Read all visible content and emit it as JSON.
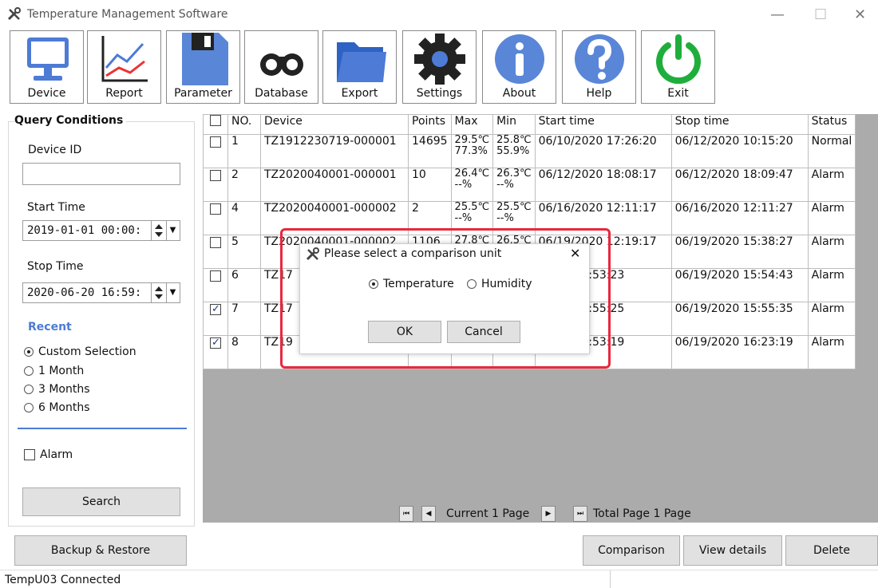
{
  "window": {
    "title": "Temperature Management Software",
    "minimize": "—",
    "maximize": "☐",
    "close": "✕"
  },
  "toolbar": [
    {
      "label": "Device",
      "icon": "monitor-icon"
    },
    {
      "label": "Report",
      "icon": "chart-icon"
    },
    {
      "label": "Parameter",
      "icon": "floppy-icon"
    },
    {
      "label": "Database",
      "icon": "binoculars-icon"
    },
    {
      "label": "Export",
      "icon": "folder-icon"
    },
    {
      "label": "Settings",
      "icon": "gear-icon"
    },
    {
      "label": "About",
      "icon": "info-icon"
    },
    {
      "label": "Help",
      "icon": "help-icon"
    },
    {
      "label": "Exit",
      "icon": "power-icon"
    }
  ],
  "query": {
    "title": "Query Conditions",
    "device_id_label": "Device ID",
    "device_id_value": "",
    "start_label": "Start Time",
    "start_value": "2019-01-01 00:00:",
    "stop_label": "Stop Time",
    "stop_value": "2020-06-20 16:59:",
    "recent_label": "Recent",
    "options": [
      "Custom Selection",
      "1 Month",
      "3 Months",
      "6 Months"
    ],
    "selected_option": "Custom Selection",
    "alarm_label": "Alarm",
    "alarm_checked": false,
    "search_label": "Search"
  },
  "table": {
    "headers": [
      "NO.",
      "Device",
      "Points",
      "Max",
      "Min",
      "Start time",
      "Stop time",
      "Status"
    ],
    "rows": [
      {
        "checked": false,
        "no": "1",
        "device": "TZ1912230719-000001",
        "points": "14695",
        "max": "29.5℃",
        "max2": "77.3%",
        "min": "25.8℃",
        "min2": "55.9%",
        "start": "06/10/2020 17:26:20",
        "stop": "06/12/2020 10:15:20",
        "status": "Normal"
      },
      {
        "checked": false,
        "no": "2",
        "device": "TZ2020040001-000001",
        "points": "10",
        "max": "26.4℃",
        "max2": "--%",
        "min": "26.3℃",
        "min2": "--%",
        "start": "06/12/2020 18:08:17",
        "stop": "06/12/2020 18:09:47",
        "status": "Alarm"
      },
      {
        "checked": false,
        "no": "4",
        "device": "TZ2020040001-000002",
        "points": "2",
        "max": "25.5℃",
        "max2": "--%",
        "min": "25.5℃",
        "min2": "--%",
        "start": "06/16/2020 12:11:17",
        "stop": "06/16/2020 12:11:27",
        "status": "Alarm"
      },
      {
        "checked": false,
        "no": "5",
        "device": "TZ2020040001-000002",
        "points": "1106",
        "max": "27.8℃",
        "max2": "",
        "min": "26.5℃",
        "min2": "",
        "start": "06/19/2020 12:19:17",
        "stop": "06/19/2020 15:38:27",
        "status": "Alarm"
      },
      {
        "checked": false,
        "no": "6",
        "device": "TZ17",
        "points": "",
        "max": "",
        "max2": "",
        "min": "",
        "min2": "",
        "start": "/2020 15:53:23",
        "stop": "06/19/2020 15:54:43",
        "status": "Alarm"
      },
      {
        "checked": true,
        "no": "7",
        "device": "TZ17",
        "points": "",
        "max": "",
        "max2": "",
        "min": "",
        "min2": "",
        "start": "/2020 15:55:25",
        "stop": "06/19/2020 15:55:35",
        "status": "Alarm"
      },
      {
        "checked": true,
        "no": "8",
        "device": "TZ19",
        "points": "",
        "max": "",
        "max2": "",
        "min": "",
        "min2": "",
        "start": "/2020 15:53:19",
        "stop": "06/19/2020 16:23:19",
        "status": "Alarm"
      }
    ]
  },
  "pager": {
    "current": "Current 1 Page",
    "total": "Total Page 1 Page"
  },
  "actions": {
    "backup": "Backup & Restore",
    "comparison": "Comparison",
    "details": "View details",
    "delete": "Delete"
  },
  "dialog": {
    "title": "Please select a comparison unit",
    "opt_temperature": "Temperature",
    "opt_humidity": "Humidity",
    "selected": "Temperature",
    "ok": "OK",
    "cancel": "Cancel",
    "close": "✕"
  },
  "status": {
    "text": "TempU03 Connected"
  },
  "colors": {
    "accent": "#4d7bd5",
    "highlight": "#e8283f",
    "exit_green": "#1fae3c"
  }
}
